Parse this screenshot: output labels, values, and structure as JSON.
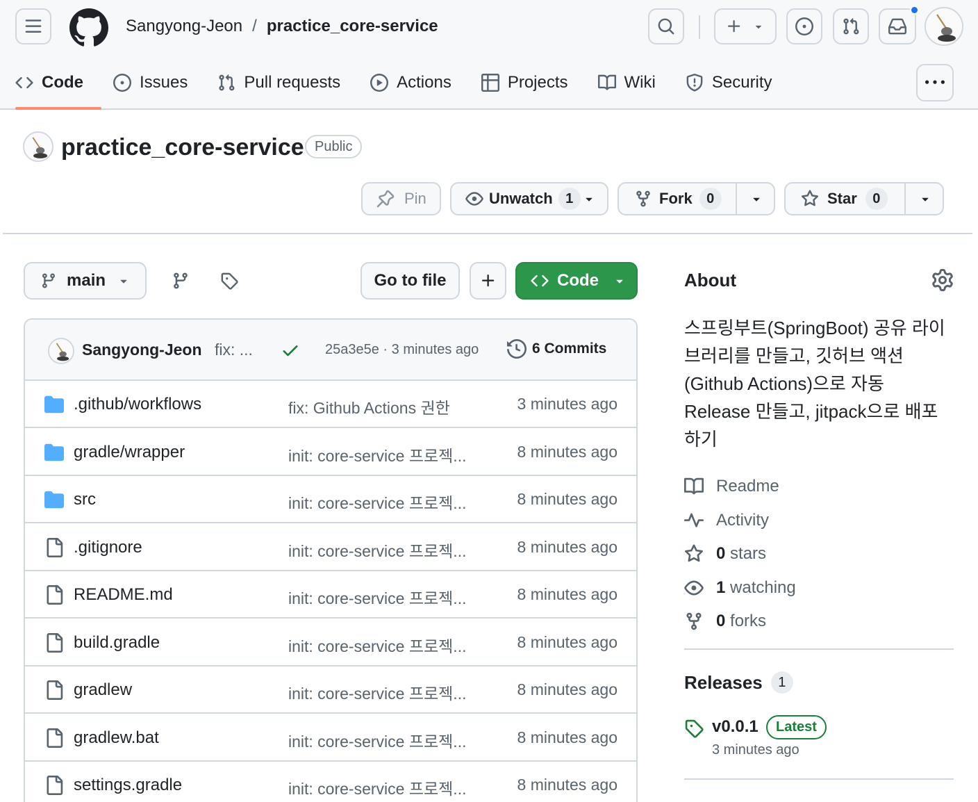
{
  "header": {
    "owner": "Sangyong-Jeon",
    "separator": "/",
    "repo": "practice_core-service"
  },
  "tabs": [
    {
      "label": "Code",
      "icon": "code-icon",
      "active": true
    },
    {
      "label": "Issues",
      "icon": "issue-icon"
    },
    {
      "label": "Pull requests",
      "icon": "pull-request-icon"
    },
    {
      "label": "Actions",
      "icon": "play-icon"
    },
    {
      "label": "Projects",
      "icon": "table-icon"
    },
    {
      "label": "Wiki",
      "icon": "book-icon"
    },
    {
      "label": "Security",
      "icon": "shield-icon"
    }
  ],
  "repo": {
    "title": "practice_core-service",
    "visibility": "Public"
  },
  "actions": {
    "pin_label": "Pin",
    "watch_label": "Unwatch",
    "watch_count": "1",
    "fork_label": "Fork",
    "fork_count": "0",
    "star_label": "Star",
    "star_count": "0"
  },
  "branchbar": {
    "branch": "main",
    "goto_label": "Go to file",
    "code_label": "Code"
  },
  "latest_commit": {
    "author": "Sangyong-Jeon",
    "message": "fix: ...",
    "hash_time": "25a3e5e · 3 minutes ago",
    "commits": "6 Commits"
  },
  "files": [
    {
      "name": ".github/workflows",
      "type": "folder",
      "commit": "fix: Github Actions 권한",
      "age": "3 minutes ago"
    },
    {
      "name": "gradle/wrapper",
      "type": "folder",
      "commit": "init: core-service 프로젝...",
      "age": "8 minutes ago"
    },
    {
      "name": "src",
      "type": "folder",
      "commit": "init: core-service 프로젝...",
      "age": "8 minutes ago"
    },
    {
      "name": ".gitignore",
      "type": "file",
      "commit": "init: core-service 프로젝...",
      "age": "8 minutes ago"
    },
    {
      "name": "README.md",
      "type": "file",
      "commit": "init: core-service 프로젝...",
      "age": "8 minutes ago"
    },
    {
      "name": "build.gradle",
      "type": "file",
      "commit": "init: core-service 프로젝...",
      "age": "8 minutes ago"
    },
    {
      "name": "gradlew",
      "type": "file",
      "commit": "init: core-service 프로젝...",
      "age": "8 minutes ago"
    },
    {
      "name": "gradlew.bat",
      "type": "file",
      "commit": "init: core-service 프로젝...",
      "age": "8 minutes ago"
    },
    {
      "name": "settings.gradle",
      "type": "file",
      "commit": "init: core-service 프로젝...",
      "age": "8 minutes ago"
    }
  ],
  "about": {
    "title": "About",
    "description_lines": [
      "스프링부트(SpringBoot) 공유 라이",
      "브러리를 만들고, 깃허브 액션",
      "(Github Actions)으로 자동",
      "Release 만들고, jitpack으로 배포",
      "하기"
    ],
    "readme": "Readme",
    "activity": "Activity",
    "stars_count": "0",
    "stars_label": "stars",
    "watching_count": "1",
    "watching_label": "watching",
    "forks_count": "0",
    "forks_label": "forks"
  },
  "releases": {
    "title": "Releases",
    "count": "1",
    "latest_name": "v0.0.1",
    "latest_badge": "Latest",
    "latest_time": "3 minutes ago"
  },
  "colors": {
    "accent_green": "#2c974b",
    "tab_underline": "#fd8c73",
    "folder_blue": "#54aeff",
    "notification_blue": "#1f6feb"
  }
}
